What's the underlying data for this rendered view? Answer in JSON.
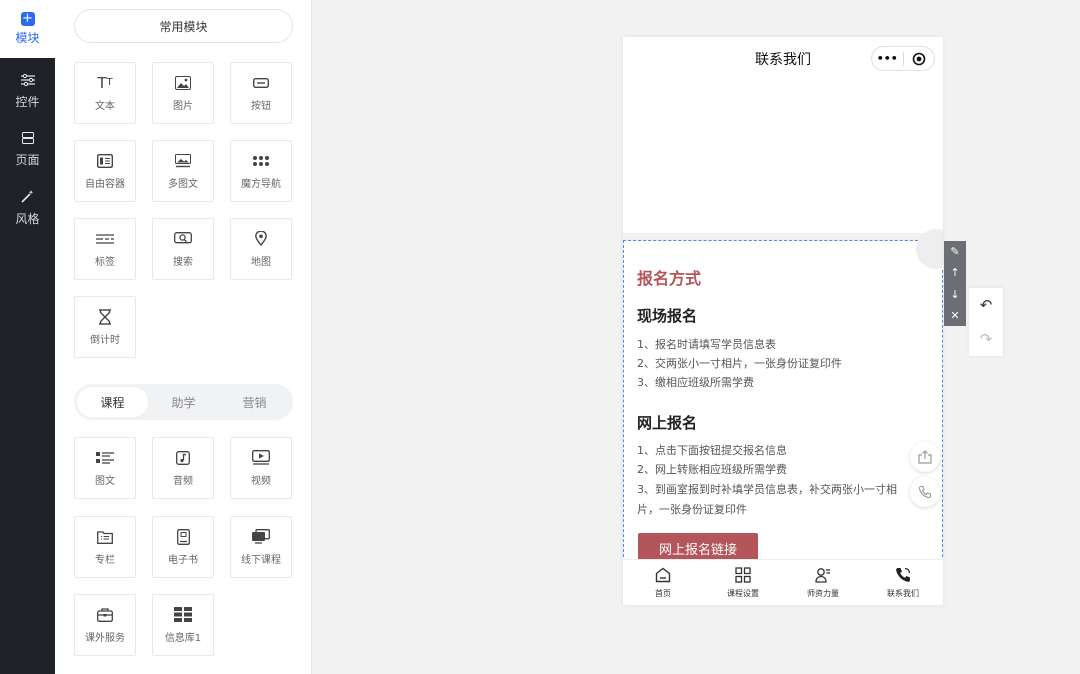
{
  "rail": {
    "items": [
      {
        "label": "模块",
        "icon": "plus-square-icon"
      },
      {
        "label": "控件",
        "icon": "sliders-icon"
      },
      {
        "label": "页面",
        "icon": "pages-icon"
      },
      {
        "label": "风格",
        "icon": "magic-wand-icon"
      }
    ]
  },
  "panel": {
    "common_tab": "常用模块",
    "basic_tiles": [
      {
        "label": "文本",
        "icon": "text-icon"
      },
      {
        "label": "图片",
        "icon": "image-icon"
      },
      {
        "label": "按钮",
        "icon": "button-icon"
      },
      {
        "label": "自由容器",
        "icon": "container-icon"
      },
      {
        "label": "多图文",
        "icon": "multi-image-icon"
      },
      {
        "label": "魔方导航",
        "icon": "grid-dots-icon"
      },
      {
        "label": "标签",
        "icon": "tag-icon"
      },
      {
        "label": "搜索",
        "icon": "search-icon"
      },
      {
        "label": "地图",
        "icon": "map-pin-icon"
      },
      {
        "label": "倒计时",
        "icon": "hourglass-icon"
      }
    ],
    "segments": [
      "课程",
      "助学",
      "营销"
    ],
    "active_segment": "课程",
    "course_tiles": [
      {
        "label": "图文",
        "icon": "article-icon"
      },
      {
        "label": "音频",
        "icon": "audio-icon"
      },
      {
        "label": "视频",
        "icon": "video-icon"
      },
      {
        "label": "专栏",
        "icon": "column-icon"
      },
      {
        "label": "电子书",
        "icon": "ebook-icon"
      },
      {
        "label": "线下课程",
        "icon": "offline-course-icon"
      },
      {
        "label": "课外服务",
        "icon": "service-box-icon"
      },
      {
        "label": "信息库1",
        "icon": "database-icon"
      }
    ]
  },
  "phone": {
    "nav_title": "联系我们",
    "capsule": {
      "more": "•••",
      "close": "◉"
    },
    "section_title": "报名方式",
    "onsite": {
      "title": "现场报名",
      "lines": [
        "1、报名时请填写学员信息表",
        "2、交两张小一寸相片，一张身份证复印件",
        "3、缴相应班级所需学费"
      ]
    },
    "online": {
      "title": "网上报名",
      "lines": [
        "1、点击下面按钮提交报名信息",
        "2、网上转账相应班级所需学费",
        "3、到画室报到时补填学员信息表，补交两张小一寸相",
        "片，一张身份证复印件"
      ]
    },
    "register_button": "网上报名链接",
    "tabbar": [
      {
        "label": "首页",
        "icon": "home-icon"
      },
      {
        "label": "课程设置",
        "icon": "grid-icon"
      },
      {
        "label": "师资力量",
        "icon": "teacher-icon"
      },
      {
        "label": "联系我们",
        "icon": "phone-icon"
      }
    ]
  },
  "toolbar": {
    "edit": "✎",
    "up": "↑",
    "down": "↓",
    "delete": "✕",
    "undo": "↶",
    "redo": "↷"
  },
  "colors": {
    "accent": "#2a6bf1",
    "brand": "#b4555b",
    "rail_bg": "#1f2226"
  }
}
